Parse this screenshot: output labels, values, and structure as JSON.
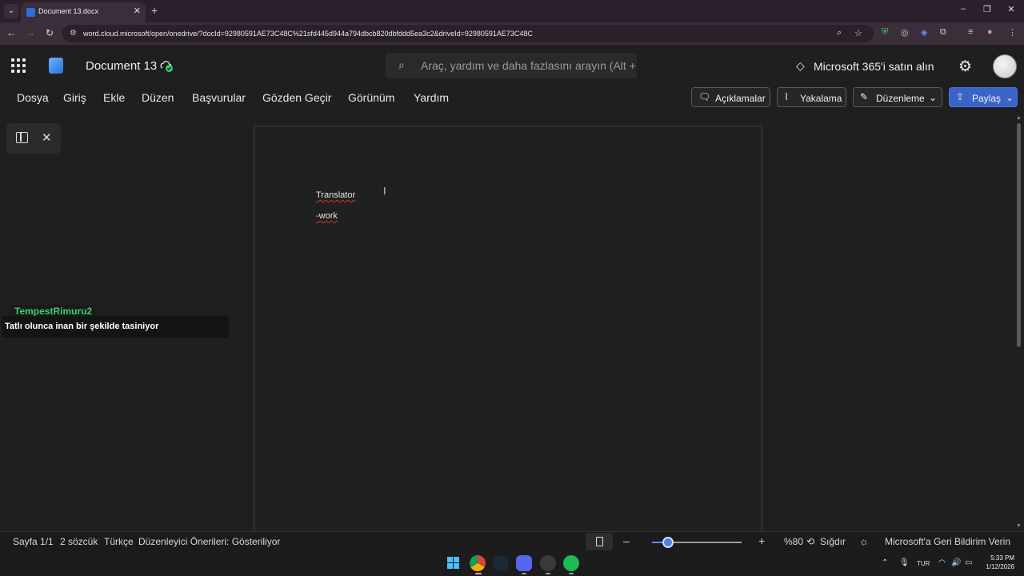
{
  "browser": {
    "tab_title": "Document 13.docx",
    "url": "word.cloud.microsoft/open/onedrive/?docId=92980591AE73C48C%21sfd445d944a794dbcb820dbfddd5ea3c2&driveId=92980591AE73C48C"
  },
  "header": {
    "doc_title": "Document 13",
    "search_placeholder": "Araç, yardım ve daha fazlasını arayın (Alt + Q)",
    "buy_label": "Microsoft 365'i satın alın"
  },
  "ribbon": {
    "tabs": [
      "Dosya",
      "Giriş",
      "Ekle",
      "Düzen",
      "Başvurular",
      "Gözden Geçir",
      "Görünüm",
      "Yardım"
    ],
    "comments_label": "Açıklamalar",
    "catchup_label": "Yakalama",
    "editing_label": "Düzenleme",
    "share_label": "Paylaş"
  },
  "document": {
    "lines": [
      "Translator",
      "-work"
    ]
  },
  "overlay": {
    "username": "TempestRimuru2",
    "message": "Tatlı olunca inan bir şekilde tasiniyor"
  },
  "status": {
    "page": "Sayfa 1/1",
    "words": "2 sözcük",
    "language": "Türkçe",
    "editor": "Düzenleyici Önerileri: Gösteriliyor",
    "zoom": "%80",
    "zoom_fraction": 0.18,
    "fit": "Sığdır",
    "feedback": "Microsoft'a Geri Bildirim Verin"
  },
  "taskbar": {
    "lang": "TUR",
    "time": "5:33 PM",
    "date": "1/12/2026"
  },
  "colors": {
    "share_button": "#3b64c9",
    "username": "#3ccf6e",
    "spell_squiggle": "#d13438"
  }
}
